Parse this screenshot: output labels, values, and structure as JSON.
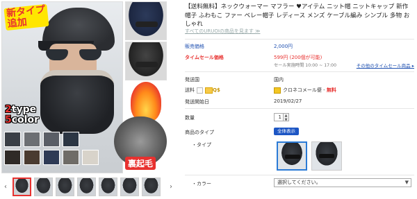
{
  "product": {
    "title": "【送料無料】ネックウォーマー マフラー ♥アイテム ニット帽 ニットキャップ 新作 帽子 ふわもこ ファー ベレー帽子 レディース メンズ ケーブル編み シンプル 多物 おしゃれ",
    "all_products_link": "すべてのURUOIの商品を見ます ≫"
  },
  "image": {
    "badge_new_line1": "新タイプ",
    "badge_new_line2": "追加",
    "type_line1_num": "2",
    "type_line1_word": "type",
    "type_line2_num": "5",
    "type_line2_word": "color",
    "reverse_label": "裏起毛",
    "swatch_colors": [
      "#3a3f46",
      "#6c6f73",
      "#5a5e66",
      "#2c3644",
      "#2f2a27",
      "#4a3b30",
      "#2e3a55",
      "#6f6c67",
      "#d8d3ca"
    ],
    "thumbnail_count": 8,
    "arrow_left": "‹",
    "arrow_right": "›"
  },
  "pricing": {
    "regular_label": "販売価格",
    "regular_value": "2,000円",
    "sale_label": "タイムセール価格",
    "sale_value": "599円 (200個が可能)",
    "sale_period": "セール実施時間 10:00 ~ 17:00",
    "sale_list_link": "その他のタイムセール商品 ▸"
  },
  "shipping": {
    "origin_label": "発送国",
    "origin_value": "国内",
    "fee_label": "送料",
    "fee_q": "Q$",
    "carrier": "クロネコメール便 - ",
    "carrier_fee": "無料",
    "start_label": "発送開始日",
    "start_value": "2019/02/27"
  },
  "order": {
    "qty_label": "数量",
    "qty_value": "1",
    "type_label": "商品のタイプ",
    "show_all_button": "全体表示",
    "type_sub_label": "・タイプ",
    "color_label": "・カラー",
    "color_placeholder": "選択してください。",
    "spin_up": "▲",
    "spin_down": "▼",
    "select_arrow": "▼"
  }
}
